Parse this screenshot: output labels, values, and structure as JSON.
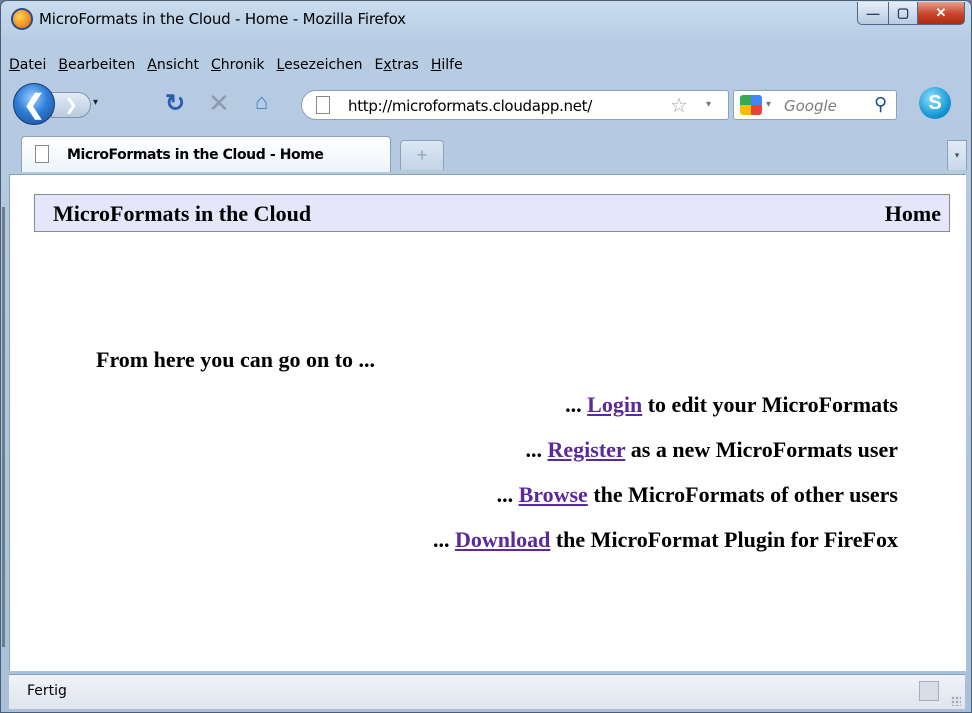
{
  "window": {
    "title": "MicroFormats in the Cloud - Home - Mozilla Firefox",
    "min_glyph": "—",
    "max_glyph": "▢",
    "close_glyph": "✕"
  },
  "menu": [
    {
      "accel": "D",
      "rest": "atei"
    },
    {
      "accel": "B",
      "rest": "earbeiten"
    },
    {
      "accel": "A",
      "rest": "nsicht"
    },
    {
      "accel": "C",
      "rest": "hronik"
    },
    {
      "accel": "L",
      "rest": "esezeichen"
    },
    {
      "pre": "E",
      "accel": "x",
      "rest": "tras"
    },
    {
      "accel": "H",
      "rest": "ilfe"
    }
  ],
  "nav": {
    "back_glyph": "❮",
    "forward_glyph": "❯",
    "dropdown_glyph": "▾",
    "reload_glyph": "↻",
    "stop_glyph": "✕",
    "home_glyph": "⌂",
    "url": "http://microformats.cloudapp.net/",
    "star_glyph": "☆",
    "search_placeholder": "Google",
    "search_glyph": "⚲",
    "skype_glyph": "S"
  },
  "tabs": {
    "active_label": "MicroFormats in the Cloud - Home",
    "new_tab_glyph": "+",
    "list_glyph": "▾"
  },
  "page": {
    "site_title": "MicroFormats in the Cloud",
    "home_link": "Home",
    "intro": "From here you can go on to ...",
    "links": [
      {
        "prefix": "... ",
        "link": "Login",
        "suffix": " to edit your MicroFormats"
      },
      {
        "prefix": "... ",
        "link": "Register",
        "suffix": " as a new MicroFormats user"
      },
      {
        "prefix": "... ",
        "link": "Browse",
        "suffix": " the MicroFormats of other users"
      },
      {
        "prefix": "... ",
        "link": "Download",
        "suffix": " the MicroFormat Plugin for FireFox"
      }
    ],
    "link_color": "#5a2a9a",
    "header_bg": "#e6e6fa"
  },
  "status": {
    "text": "Fertig"
  }
}
